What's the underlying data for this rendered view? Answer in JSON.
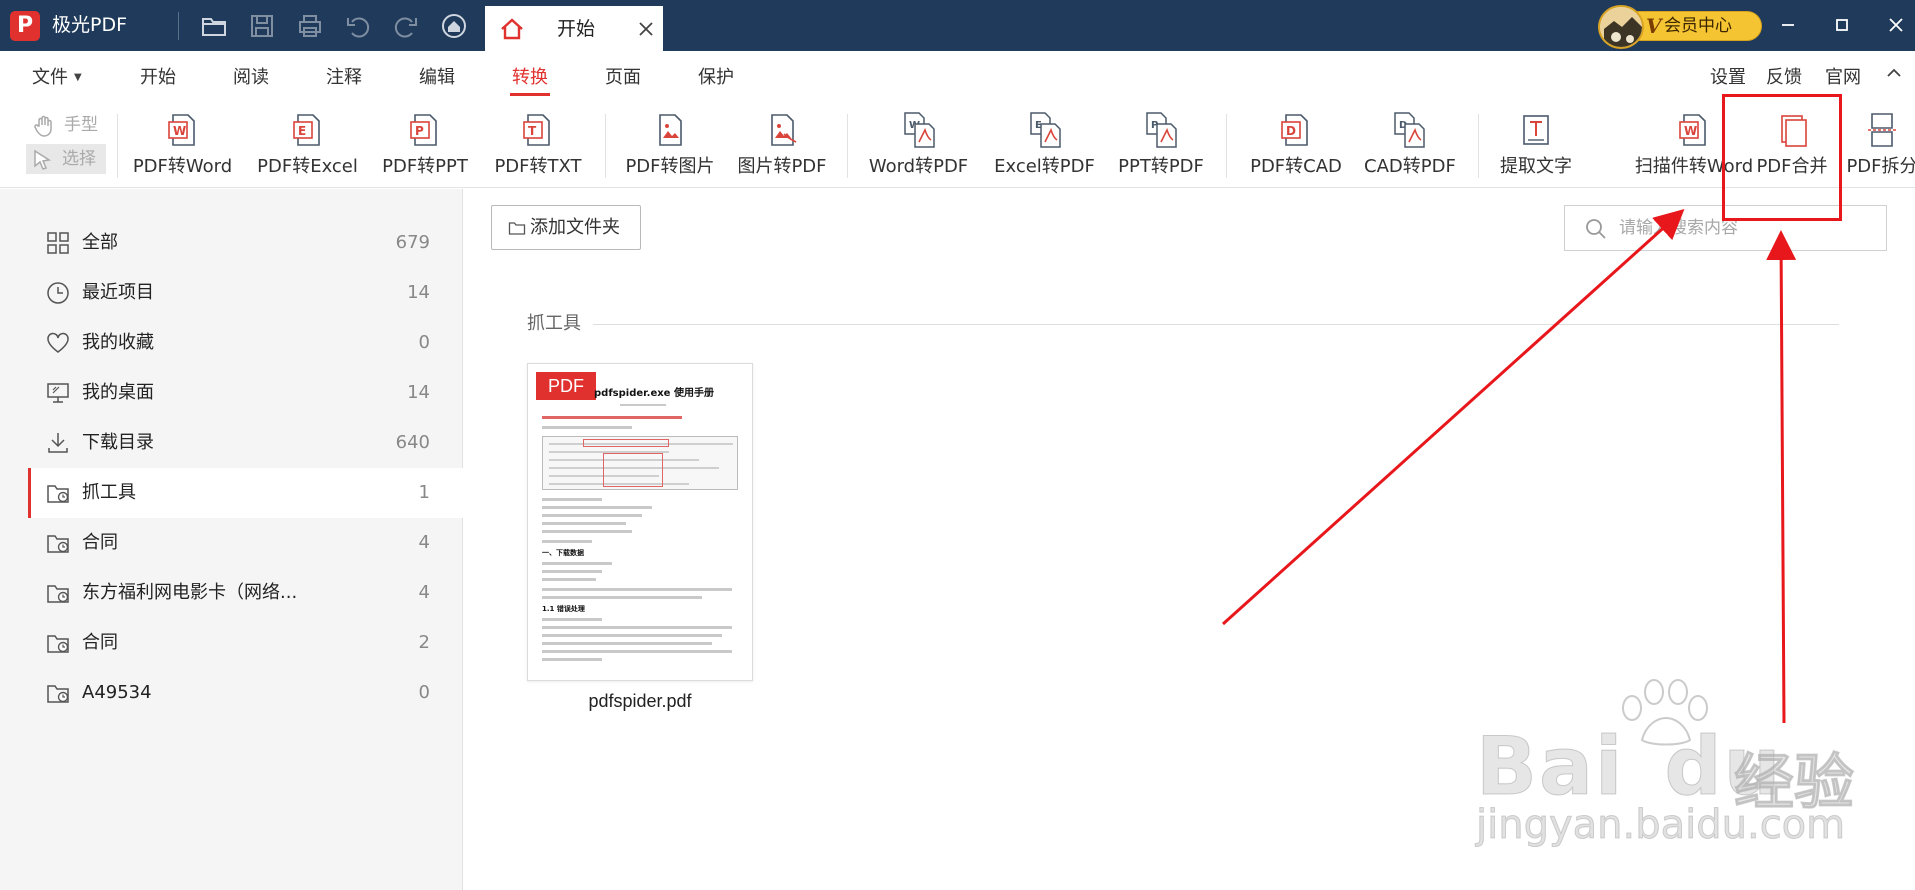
{
  "app": {
    "name": "极光PDF",
    "logo_letter": "P"
  },
  "titlebar": {
    "tab_label": "开始",
    "vip_label": "会员中心",
    "vip_badge": "V"
  },
  "menu": {
    "items": [
      "文件",
      "开始",
      "阅读",
      "注释",
      "编辑",
      "转换",
      "页面",
      "保护"
    ],
    "active": "转换",
    "right": [
      "设置",
      "反馈",
      "官网"
    ]
  },
  "ribbon": {
    "hand_tool": "手型",
    "select_tool": "选择",
    "buttons": [
      "PDF转Word",
      "PDF转Excel",
      "PDF转PPT",
      "PDF转TXT",
      "PDF转图片",
      "图片转PDF",
      "Word转PDF",
      "Excel转PDF",
      "PPT转PDF",
      "PDF转CAD",
      "CAD转PDF",
      "提取文字",
      "扫描件转Word",
      "PDF合并",
      "PDF拆分"
    ]
  },
  "sidebar": {
    "items": [
      {
        "label": "全部",
        "count": "679",
        "icon": "grid-icon"
      },
      {
        "label": "最近项目",
        "count": "14",
        "icon": "clock-icon"
      },
      {
        "label": "我的收藏",
        "count": "0",
        "icon": "heart-icon"
      },
      {
        "label": "我的桌面",
        "count": "14",
        "icon": "monitor-icon"
      },
      {
        "label": "下载目录",
        "count": "640",
        "icon": "download-icon"
      },
      {
        "label": "抓工具",
        "count": "1",
        "icon": "folder-clock-icon"
      },
      {
        "label": "合同",
        "count": "4",
        "icon": "folder-clock-icon"
      },
      {
        "label": "东方福利网电影卡（网络...",
        "count": "4",
        "icon": "folder-clock-icon"
      },
      {
        "label": "合同",
        "count": "2",
        "icon": "folder-clock-icon"
      },
      {
        "label": "A49534",
        "count": "0",
        "icon": "folder-clock-icon"
      }
    ],
    "active_index": 5
  },
  "main": {
    "add_folder_label": "添加文件夹",
    "search_placeholder": "请输入搜索内容",
    "section_title": "抓工具",
    "file": {
      "badge": "PDF",
      "name": "pdfspider.pdf",
      "preview_title": "pdfspider.exe 使用手册",
      "preview_heading1": "一、下载数据",
      "preview_heading2": "1.1 错误处理"
    }
  },
  "watermark": {
    "brand": "Bai",
    "brand2": "du",
    "jingyan": "经验",
    "url": "jingyan.baidu.com"
  },
  "colors": {
    "titlebar": "#1f3a5a",
    "accent": "#e0312e",
    "annotation": "#e8171c",
    "vip": "#f5c433"
  }
}
